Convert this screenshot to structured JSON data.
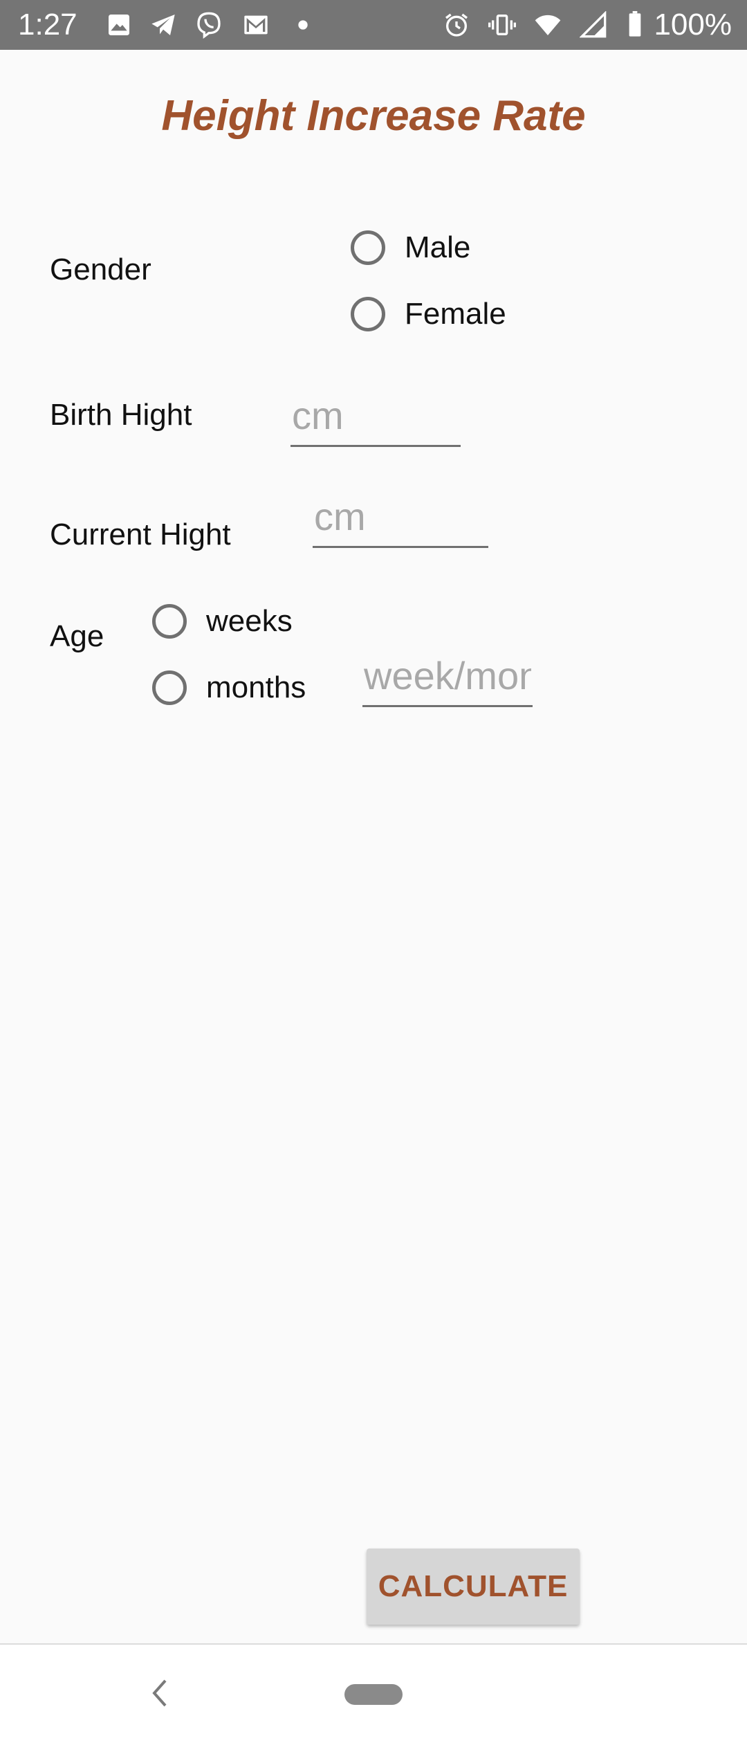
{
  "status_bar": {
    "time": "1:27",
    "battery": "100%",
    "icons": [
      "image-icon",
      "telegram-icon",
      "viber-icon",
      "gmail-icon",
      "dot-icon",
      "alarm-icon",
      "vibrate-icon",
      "wifi-icon",
      "signal-icon",
      "battery-icon"
    ]
  },
  "title": "Height Increase Rate",
  "gender": {
    "label": "Gender",
    "options": [
      "Male",
      "Female"
    ]
  },
  "birth_height": {
    "label": "Birth Hight",
    "placeholder": "cm",
    "value": ""
  },
  "current_height": {
    "label": "Current Hight",
    "placeholder": "cm",
    "value": ""
  },
  "age": {
    "label": "Age",
    "options": [
      "weeks",
      "months"
    ],
    "placeholder": "week/month",
    "value": ""
  },
  "calculate_button": "CALCULATE",
  "colors": {
    "accent": "#a0522d",
    "status_bar": "#757575",
    "background": "#fafafa",
    "button_bg": "#d6d6d6"
  }
}
